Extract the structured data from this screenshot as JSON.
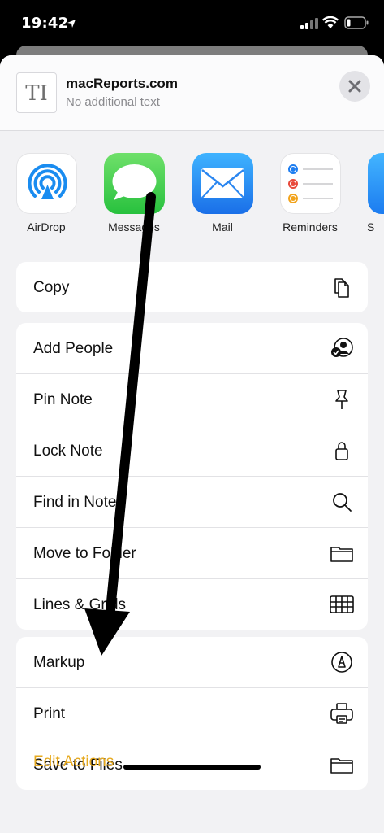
{
  "status_bar": {
    "time": "19:42",
    "icons": [
      "location-arrow-icon",
      "cellular-signal-icon",
      "wifi-icon",
      "battery-icon"
    ]
  },
  "header": {
    "title": "macReports.com",
    "subtitle": "No additional text",
    "thumbnail_glyph": "TI",
    "close_icon": "close-icon"
  },
  "apps": [
    {
      "label": "AirDrop",
      "icon": "airdrop-icon"
    },
    {
      "label": "Messages",
      "icon": "messages-icon"
    },
    {
      "label": "Mail",
      "icon": "mail-icon"
    },
    {
      "label": "Reminders",
      "icon": "reminders-icon"
    },
    {
      "label": "S",
      "icon": "app-icon-partial"
    }
  ],
  "groups": [
    [
      {
        "label": "Copy",
        "icon": "copy-icon"
      }
    ],
    [
      {
        "label": "Add People",
        "icon": "add-people-icon"
      },
      {
        "label": "Pin Note",
        "icon": "pin-icon"
      },
      {
        "label": "Lock Note",
        "icon": "lock-icon"
      },
      {
        "label": "Find in Note",
        "icon": "search-icon"
      },
      {
        "label": "Move to Folder",
        "icon": "folder-icon"
      },
      {
        "label": "Lines & Grids",
        "icon": "grid-icon"
      }
    ],
    [
      {
        "label": "Markup",
        "icon": "markup-icon"
      },
      {
        "label": "Print",
        "icon": "print-icon"
      },
      {
        "label": "Save to Files",
        "icon": "folder-icon"
      }
    ]
  ],
  "footer": {
    "edit_actions": "Edit Actions"
  },
  "colors": {
    "accent": "#e6a91e",
    "sheet_bg": "#f2f2f4",
    "annotation_arrow": "#000000"
  }
}
